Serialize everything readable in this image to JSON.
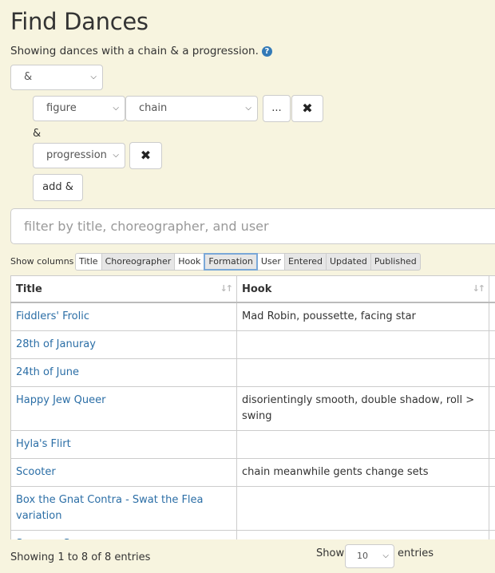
{
  "page": {
    "title": "Find Dances",
    "summary": "Showing dances with a chain & a progression.",
    "help_icon": "?"
  },
  "query": {
    "root_op": "&",
    "figure_type": "figure",
    "figure_value": "chain",
    "more_label": "...",
    "remove_glyph": "✖",
    "joiner": "&",
    "second_clause": "progression",
    "add_label": "add &"
  },
  "filter": {
    "placeholder": "filter by title, choreographer, and user"
  },
  "columns_toggle": {
    "label": "Show columns",
    "items": [
      "Title",
      "Choreographer",
      "Hook",
      "Formation",
      "User",
      "Entered",
      "Updated",
      "Published"
    ],
    "active": "Formation"
  },
  "table": {
    "headers": [
      "Title",
      "Hook"
    ],
    "sort_icon": "↓↑",
    "rows": [
      {
        "title": "Fiddlers' Frolic",
        "hook": "Mad Robin, poussette, facing star"
      },
      {
        "title": "28th of Januray",
        "hook": ""
      },
      {
        "title": "24th of June",
        "hook": ""
      },
      {
        "title": "Happy Jew Queer",
        "hook": "disorientingly smooth, double shadow, roll > swing"
      },
      {
        "title": "Hyla's Flirt",
        "hook": ""
      },
      {
        "title": "Scooter",
        "hook": "chain meanwhile gents change sets"
      },
      {
        "title": "Box the Gnat Contra - Swat the Flea variation",
        "hook": ""
      },
      {
        "title": "Summer Sun",
        "hook": ""
      }
    ]
  },
  "footer": {
    "info": "Showing 1 to 8 of 8 entries",
    "show_label": "Show",
    "length_value": "10",
    "entries_label": "entries"
  },
  "icons": {
    "chevron": "chevron-down-icon",
    "help": "question-circle-icon",
    "remove": "times-icon",
    "sort": "sort-icon"
  },
  "colors": {
    "background": "#f7f4df",
    "link": "#2b6ea6",
    "help_icon": "#337ab7"
  }
}
